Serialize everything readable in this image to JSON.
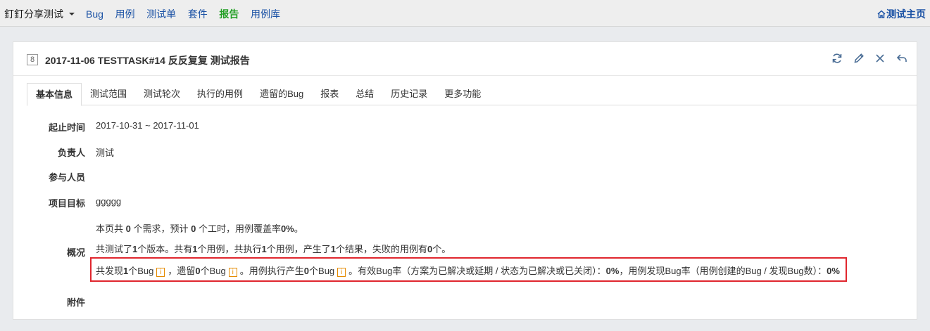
{
  "topbar": {
    "product": "釘釘分享测试",
    "nav": [
      "Bug",
      "用例",
      "测试单",
      "套件",
      "报告",
      "用例库"
    ],
    "active_nav": "报告",
    "home": "测试主页"
  },
  "panel": {
    "id": "8",
    "title": "2017-11-06 TESTTASK#14 反反复复 测试报告"
  },
  "tabs": [
    "基本信息",
    "测试范围",
    "测试轮次",
    "执行的用例",
    "遗留的Bug",
    "报表",
    "总结",
    "历史记录",
    "更多功能"
  ],
  "fields": {
    "period_label": "起止时间",
    "period_value": "2017-10-31 ~ 2017-11-01",
    "owner_label": "负责人",
    "owner_value": "测试",
    "members_label": "参与人员",
    "goal_label": "项目目标",
    "goal_value": "ggggg",
    "overview_label": "概况",
    "attach_label": "附件"
  },
  "overview": {
    "line1": {
      "a": "本页共 ",
      "n1": "0",
      "b": " 个需求，预计 ",
      "n2": "0",
      "c": " 个工时，用例覆盖率",
      "n3": "0%",
      "d": "。"
    },
    "line2": {
      "a": "共测试了",
      "n1": "1",
      "b": "个版本。共有",
      "n2": "1",
      "c": "个用例，共执行",
      "n3": "1",
      "d": "个用例，产生了",
      "n4": "1",
      "e": "个结果，失败的用例有",
      "n5": "0",
      "f": "个。"
    },
    "line3": {
      "a": "共发现",
      "n1": "1",
      "b": "个Bug",
      "c": "，遗留",
      "n2": "0",
      "d": "个Bug",
      "e": "。用例执行产生",
      "n3": "0",
      "f": "个Bug",
      "g": "。有效Bug率（方案为已解决或延期 / 状态为已解决或已关闭）：",
      "n4": "0%",
      "h": "，用例发现Bug率（用例创建的Bug / 发现Bug数）：",
      "n5": "0%",
      "link_glyph": "i"
    }
  }
}
